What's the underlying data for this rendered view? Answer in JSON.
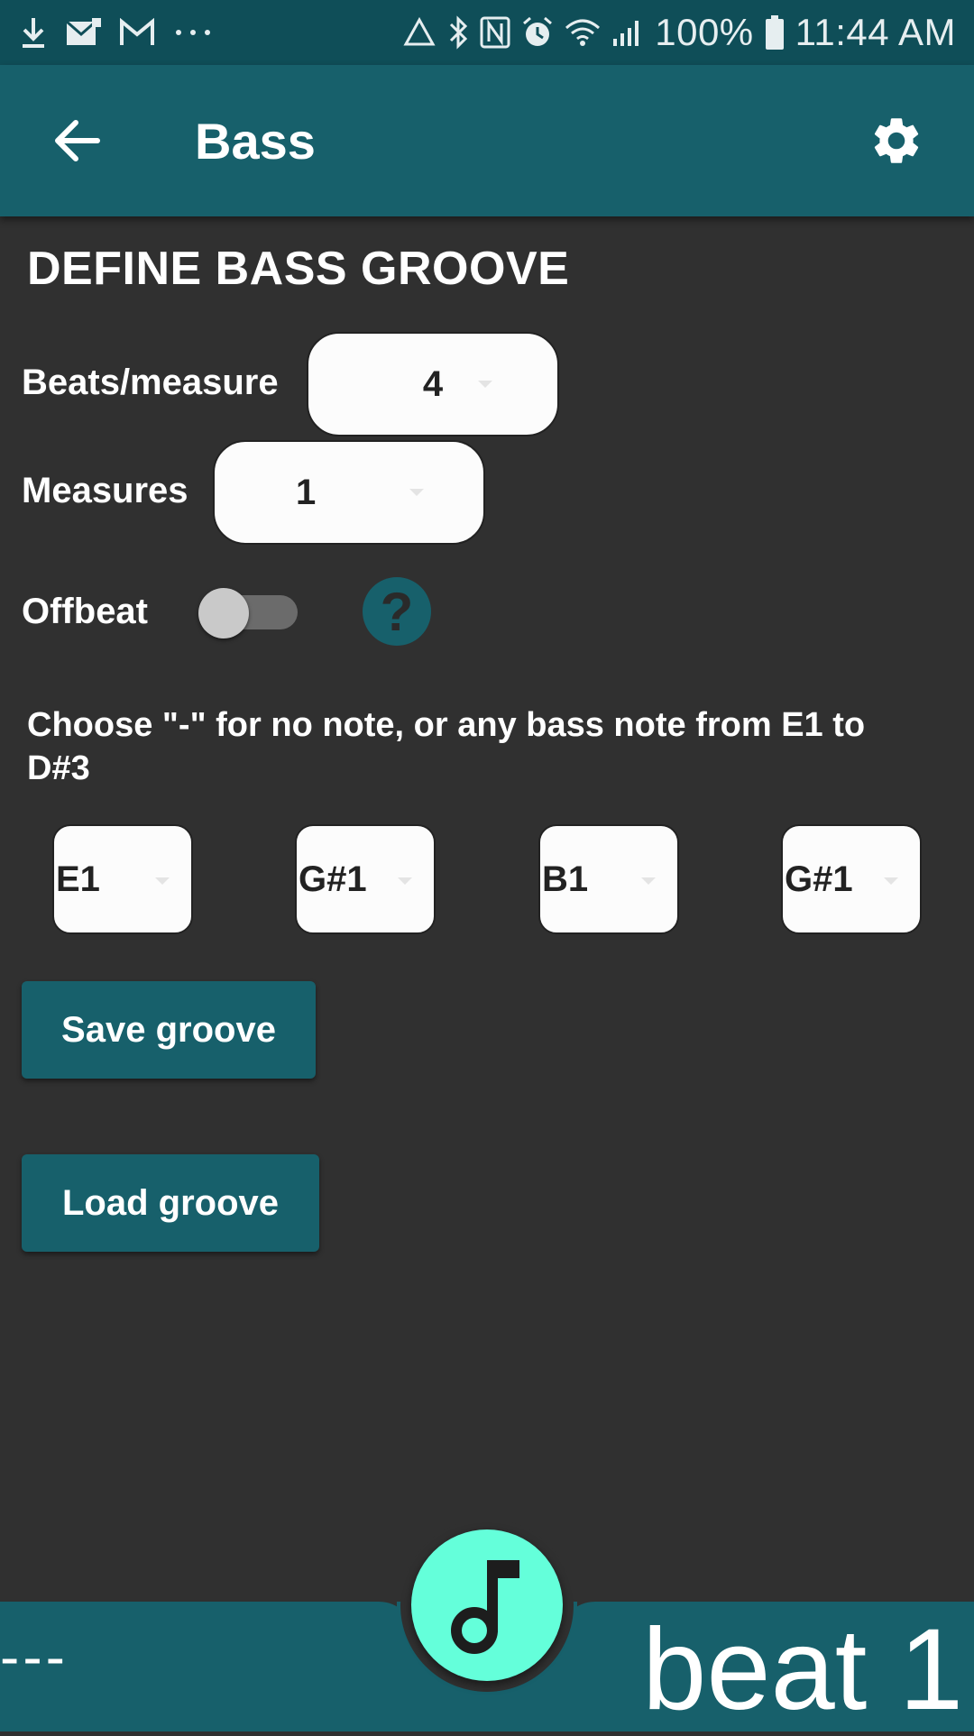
{
  "status_bar": {
    "battery": "100%",
    "time": "11:44 AM",
    "left_icons": [
      "download-icon",
      "mail-icon",
      "gmail-icon",
      "more-dots-icon"
    ],
    "right_icons": [
      "recycle-icon",
      "bluetooth-icon",
      "nfc-icon",
      "alarm-icon",
      "wifi-icon",
      "signal-icon",
      "battery-icon"
    ]
  },
  "app_bar": {
    "title": "Bass",
    "back_icon": "arrow-back-icon",
    "settings_icon": "gear-icon"
  },
  "main": {
    "section_title": "DEFINE BASS GROOVE",
    "beats_label": "Beats/measure",
    "beats_value": "4",
    "measures_label": "Measures",
    "measures_value": "1",
    "offbeat_label": "Offbeat",
    "offbeat_on": false,
    "help_label": "?",
    "instructions": "Choose \"-\" for no note, or any bass note from E1 to D#3",
    "notes": [
      "E1",
      "G#1",
      "B1",
      "G#1"
    ],
    "save_button": "Save groove",
    "load_button": "Load groove"
  },
  "bottom_bar": {
    "left_status": "---",
    "right_status": "beat 1",
    "fab_icon": "music-note-icon"
  },
  "colors": {
    "status_bar": "#0f4e58",
    "primary": "#17606b",
    "accent": "#64ffda",
    "background": "#303030"
  }
}
